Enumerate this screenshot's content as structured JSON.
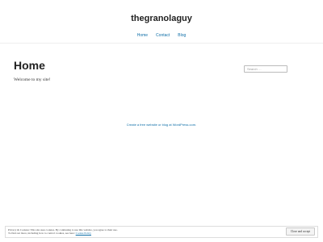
{
  "site": {
    "title": "thegranolaguy"
  },
  "nav": {
    "items": [
      {
        "label": "Home"
      },
      {
        "label": "Contact"
      },
      {
        "label": "Blog"
      }
    ]
  },
  "page": {
    "title": "Home",
    "body": "Welcome to my site!"
  },
  "search": {
    "placeholder": "Search …"
  },
  "footer": {
    "credit": "Create a free website or blog at WordPress.com."
  },
  "cookie_banner": {
    "line1": "Privacy & Cookies: This site uses cookies. By continuing to use this website, you agree to their use.",
    "line2_prefix": "To find out more, including how to control cookies, see here: ",
    "policy_link": "Cookie Policy",
    "accept_label": "Close and accept"
  },
  "colors": {
    "link": "#0f6fa8",
    "text": "#222222",
    "background": "#ffffff"
  }
}
